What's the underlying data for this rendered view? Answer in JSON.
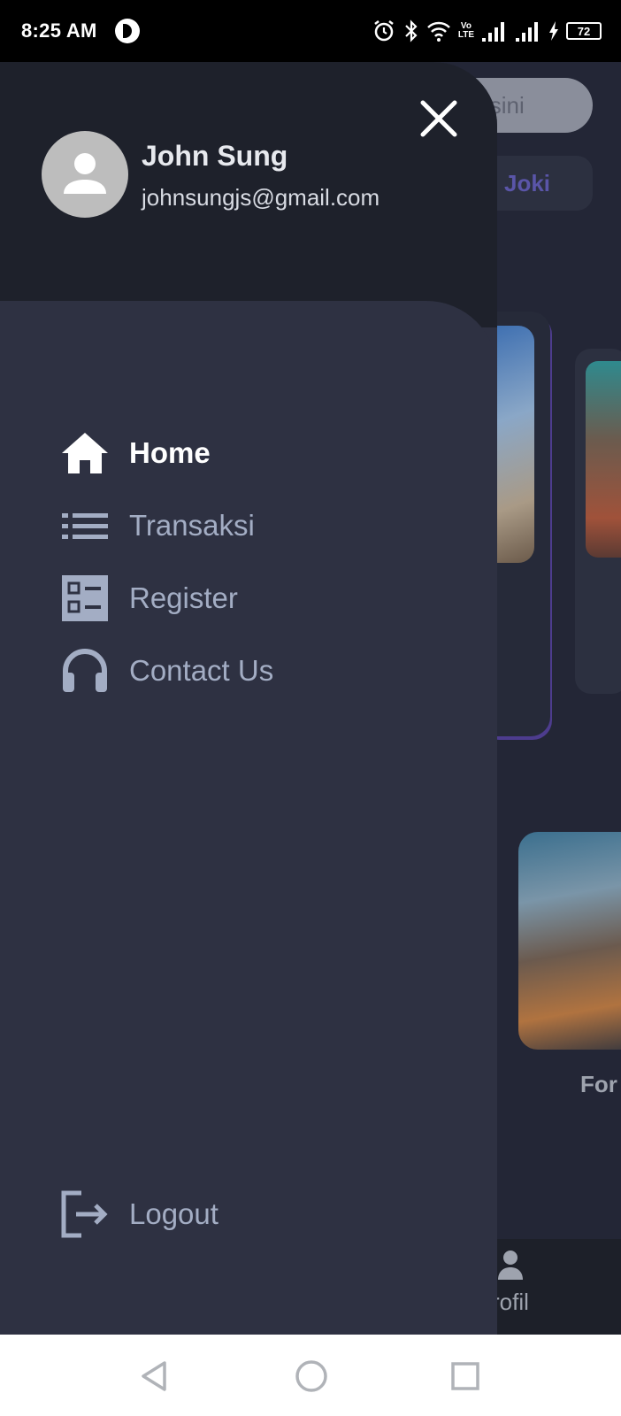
{
  "status_bar": {
    "time": "8:25 AM",
    "icons": [
      "app-notification-icon",
      "alarm-icon",
      "bluetooth-icon",
      "wifi-icon",
      "volte-icon",
      "signal-icon",
      "signal-icon",
      "charging-icon"
    ],
    "volte_top": "Vo",
    "volte_bottom": "LTE",
    "battery": "72"
  },
  "background_app": {
    "search_placeholder_fragment": "isini",
    "chip_label": "Joki",
    "card_label_fragment": "For",
    "bottom_nav_label_fragment": "rofil"
  },
  "drawer": {
    "user": {
      "name": "John Sung",
      "email": "johnsungjs@gmail.com"
    },
    "menu": [
      {
        "label": "Home",
        "icon": "home-icon",
        "active": true
      },
      {
        "label": "Transaksi",
        "icon": "list-icon",
        "active": false
      },
      {
        "label": "Register",
        "icon": "form-icon",
        "active": false
      },
      {
        "label": "Contact Us",
        "icon": "headset-icon",
        "active": false
      }
    ],
    "logout_label": "Logout"
  },
  "colors": {
    "drawer_header": "#1e212b",
    "drawer_body": "#2e3142",
    "menu_text": "#a3adc4",
    "active_text": "#ffffff",
    "chip_text": "#5a55a8"
  }
}
